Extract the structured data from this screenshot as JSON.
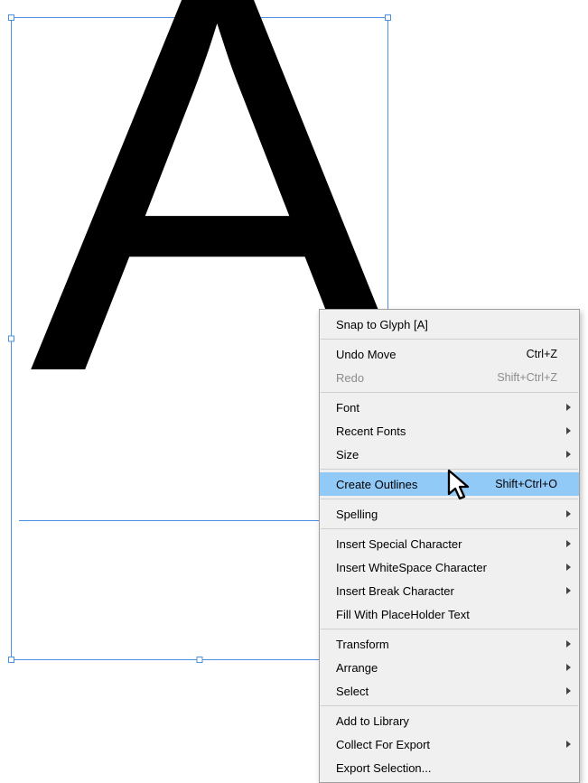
{
  "glyph": "A",
  "menu": {
    "snap": "Snap to Glyph [A]",
    "undo": {
      "label": "Undo Move",
      "shortcut": "Ctrl+Z"
    },
    "redo": {
      "label": "Redo",
      "shortcut": "Shift+Ctrl+Z"
    },
    "font": "Font",
    "recent_fonts": "Recent Fonts",
    "size": "Size",
    "create_outlines": {
      "label": "Create Outlines",
      "shortcut": "Shift+Ctrl+O"
    },
    "spelling": "Spelling",
    "insert_special": "Insert Special Character",
    "insert_whitespace": "Insert WhiteSpace Character",
    "insert_break": "Insert Break Character",
    "fill_placeholder": "Fill With PlaceHolder Text",
    "transform": "Transform",
    "arrange": "Arrange",
    "select": "Select",
    "add_library": "Add to Library",
    "collect_export": "Collect For Export",
    "export_selection": "Export Selection..."
  }
}
